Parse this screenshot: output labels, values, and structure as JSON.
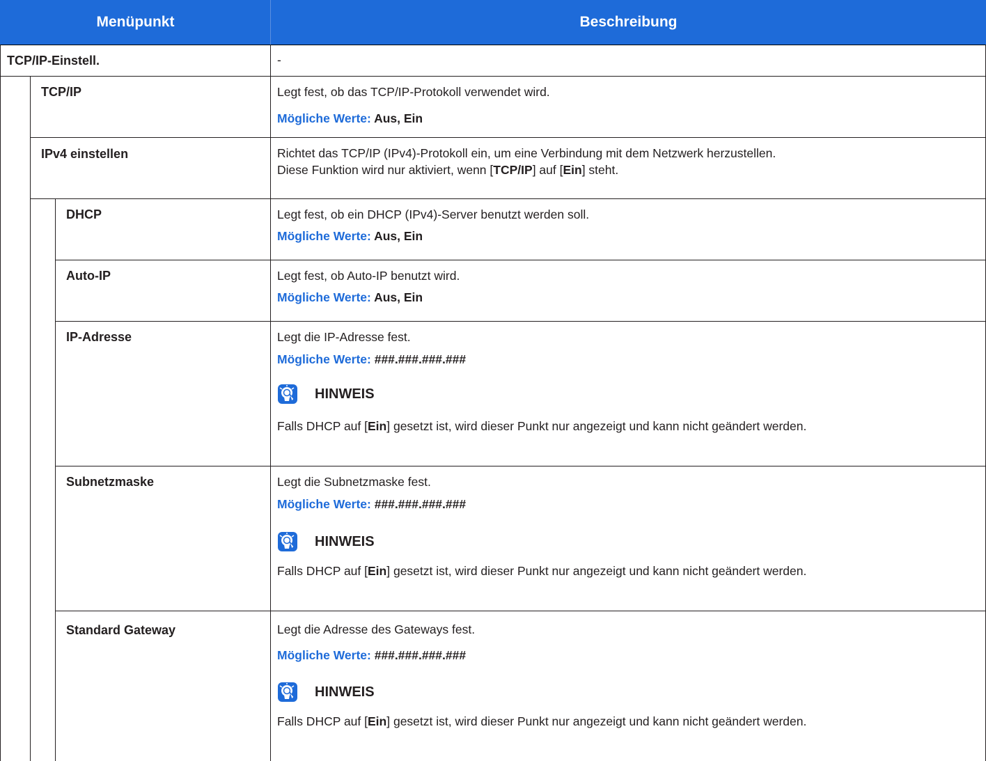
{
  "header": {
    "col1": "Menüpunkt",
    "col2": "Beschreibung"
  },
  "vals_label": "Mögliche Werte:",
  "note_title": "HINWEIS",
  "note_parts": [
    "Falls DHCP auf [",
    "Ein",
    "] gesetzt ist, wird dieser Punkt nur angezeigt und kann nicht geändert werden."
  ],
  "rows": {
    "tcpip_einstell": {
      "label": "TCP/IP-Einstell.",
      "desc": "-"
    },
    "tcpip": {
      "label": "TCP/IP",
      "desc": "Legt fest, ob das TCP/IP-Protokoll verwendet wird.",
      "values": "Aus, Ein"
    },
    "ipv4": {
      "label": "IPv4 einstellen",
      "desc_line1": "Richtet das TCP/IP (IPv4)-Protokoll ein, um eine Verbindung mit dem Netzwerk herzustellen.",
      "desc_parts": [
        "Diese Funktion wird nur aktiviert, wenn [",
        "TCP/IP",
        "] auf [",
        "Ein",
        "] steht."
      ]
    },
    "dhcp": {
      "label": "DHCP",
      "desc": "Legt fest, ob ein DHCP (IPv4)-Server benutzt werden soll.",
      "values": "Aus, Ein"
    },
    "autoip": {
      "label": "Auto-IP",
      "desc": "Legt fest, ob Auto-IP benutzt wird.",
      "values": "Aus, Ein"
    },
    "ipadresse": {
      "label": "IP-Adresse",
      "desc": "Legt die IP-Adresse fest.",
      "values": "###.###.###.###"
    },
    "subnetz": {
      "label": "Subnetzmaske",
      "desc": "Legt die Subnetzmaske fest.",
      "values": "###.###.###.###"
    },
    "gateway": {
      "label": "Standard Gateway",
      "desc": "Legt die Adresse des Gateways fest.",
      "values": "###.###.###.###"
    }
  }
}
